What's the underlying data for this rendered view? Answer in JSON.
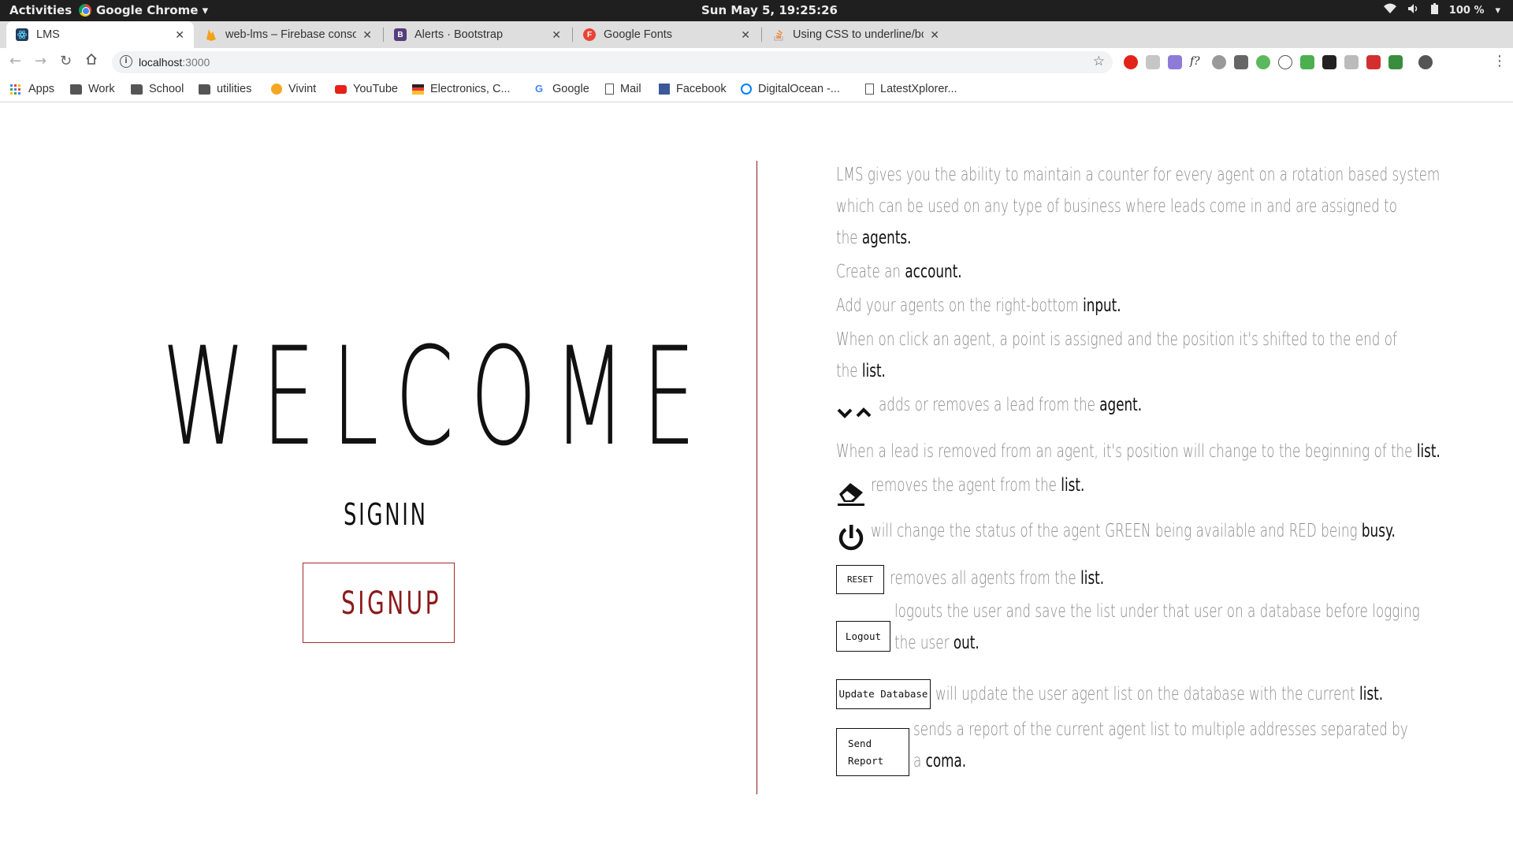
{
  "os_bar": {
    "activities": "Activities",
    "app_name": "Google Chrome ▾",
    "clock": "Sun May  5, 19:25:26",
    "battery": "100 %"
  },
  "tabs": [
    {
      "label": "LMS",
      "active": true,
      "favicon_color": "#23395b"
    },
    {
      "label": "web-lms – Firebase conso",
      "active": false,
      "favicon_color": "#f4a21a"
    },
    {
      "label": "Alerts · Bootstrap",
      "active": false,
      "favicon_color": "#563d7c"
    },
    {
      "label": "Google Fonts",
      "active": false,
      "favicon_color": "#ea4335"
    },
    {
      "label": "Using CSS to underline/bc",
      "active": false,
      "favicon_color": "#f48024"
    }
  ],
  "toolbar": {
    "url_host": "localhost",
    "url_port": ":3000"
  },
  "bookmarks": [
    {
      "label": "Apps",
      "icon": "apps-grid-icon"
    },
    {
      "label": "Work",
      "icon": "folder-icon"
    },
    {
      "label": "School",
      "icon": "folder-icon"
    },
    {
      "label": "utilities",
      "icon": "folder-icon"
    },
    {
      "label": "Vivint",
      "icon": "vivint-icon"
    },
    {
      "label": "YouTube",
      "icon": "youtube-icon"
    },
    {
      "label": "Electronics, C...",
      "icon": "electronics-icon"
    },
    {
      "label": "Google",
      "icon": "google-icon"
    },
    {
      "label": "Mail",
      "icon": "page-icon"
    },
    {
      "label": "Facebook",
      "icon": "facebook-icon"
    },
    {
      "label": "DigitalOcean -...",
      "icon": "digitalocean-icon"
    },
    {
      "label": "LatestXplorer...",
      "icon": "page-icon"
    }
  ],
  "page": {
    "welcome": "WELCOME",
    "signin": "SIGNIN",
    "signup": "SIGNUP",
    "accent_color": "#8b1a1a",
    "info": {
      "intro_1": "LMS gives you the ability to maintain a counter for every agent on a rotation based system",
      "intro_2": "which can be used on any type of business where leads come in and are assigned to",
      "intro_3a": "the ",
      "intro_3b": "agents.",
      "create_a": "Create an ",
      "create_b": "account.",
      "add_a": "Add your agents on the right-bottom ",
      "add_b": "input.",
      "click_1": "When on click an agent, a point is assigned and the position it's shifted to the end of",
      "click_2a": "the ",
      "click_2b": "list.",
      "arrows_a": "adds or removes a lead from the  ",
      "arrows_b": "agent.",
      "removed_a": "When a lead is removed from an agent, it's position will change to the beginning of the ",
      "removed_b": "list.",
      "eraser_a": "removes the agent from the  ",
      "eraser_b": "list.",
      "power_a": "will change the status of the agent GREEN being available and RED being  ",
      "power_b": "busy.",
      "reset_btn": "RESET",
      "reset_a": "removes all agents from the ",
      "reset_b": "list.",
      "logout_btn": "Logout",
      "logout_1": "logouts the user and save the list under that user on a database before logging",
      "logout_2a": "the user ",
      "logout_2b": "out.",
      "update_btn": "Update Database",
      "update_a": "will update the user agent list on the database with the current ",
      "update_b": "list.",
      "send_btn_1": "Send",
      "send_btn_2": "Report",
      "send_1": "sends a report of the current agent list to multiple addresses separated by",
      "send_2a": "a ",
      "send_2b": "coma."
    }
  }
}
